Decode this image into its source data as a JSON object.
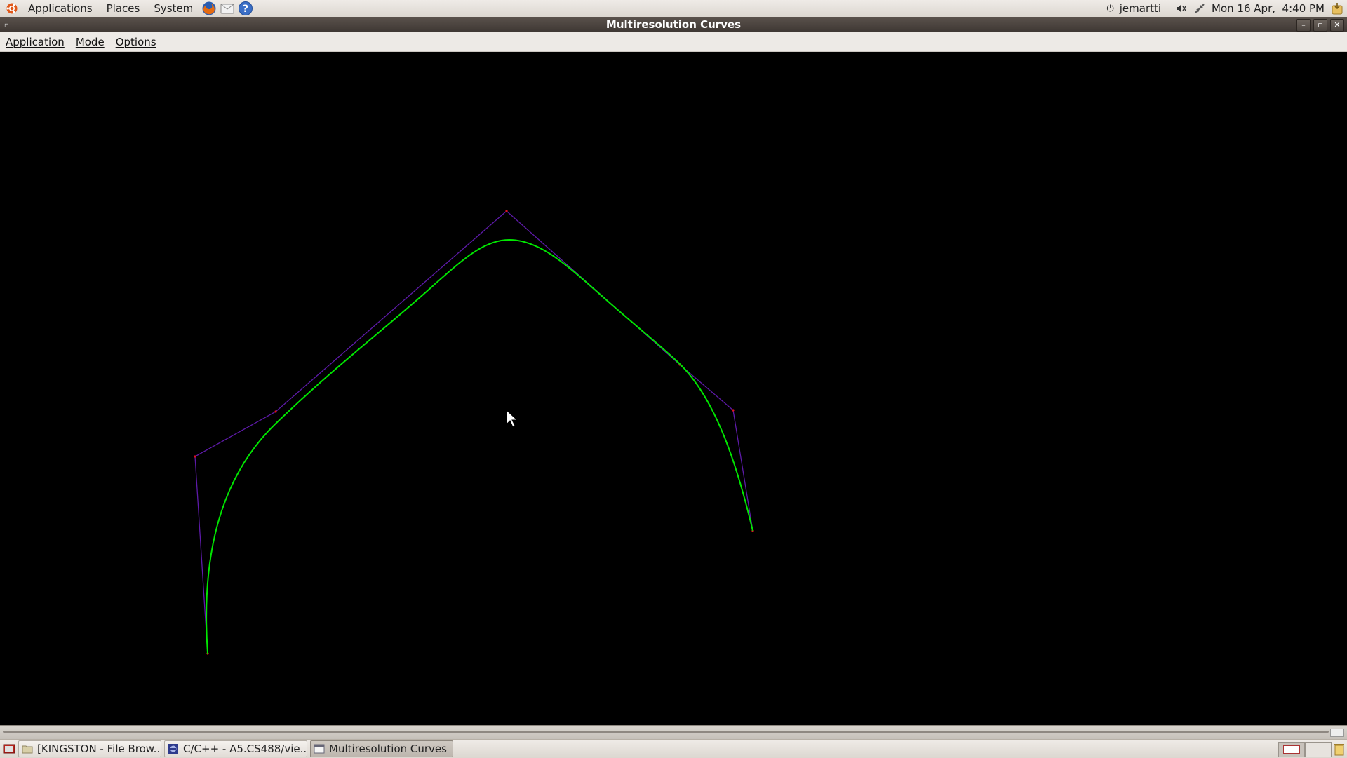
{
  "panel": {
    "menus": [
      "Applications",
      "Places",
      "System"
    ],
    "user": "jemartti",
    "datetime": "Mon 16 Apr,  4:40 PM"
  },
  "window": {
    "title": "Multiresolution Curves"
  },
  "menubar": {
    "items": [
      "Application",
      "Mode",
      "Options"
    ]
  },
  "taskbar": {
    "tasks": [
      "[KINGSTON - File Brow...",
      "C/C++ - A5.CS488/vie...",
      "Multiresolution Curves"
    ]
  },
  "colors": {
    "canvas_bg": "#000000",
    "curve": "#00e600",
    "control_polygon": "#6a1fb4",
    "control_point": "#e01020"
  }
}
